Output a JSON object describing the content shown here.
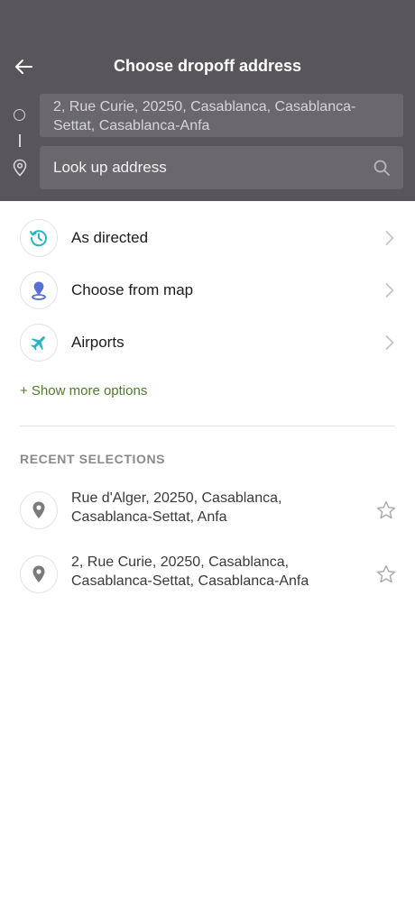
{
  "header": {
    "title": "Choose dropoff address",
    "pickup_address": "2, Rue Curie, 20250, Casablanca, Casablanca-Settat, Casablanca-Anfa",
    "lookup_placeholder": "Look up address",
    "background_color": "#58565a"
  },
  "options": [
    {
      "label": "As directed",
      "icon": "clock-arrow-icon"
    },
    {
      "label": "Choose from map",
      "icon": "map-pin-icon"
    },
    {
      "label": "Airports",
      "icon": "airplane-icon"
    }
  ],
  "show_more_label": "+ Show more options",
  "recent": {
    "heading": "RECENT SELECTIONS",
    "items": [
      {
        "address": "Rue d'Alger, 20250, Casablanca, Casablanca-Settat, Anfa"
      },
      {
        "address": "2, Rue Curie, 20250, Casablanca, Casablanca-Settat, Casablanca-Anfa"
      }
    ]
  },
  "colors": {
    "accent_teal": "#26b3c9",
    "map_blue": "#5a6fd6",
    "link_green": "#4e7a2b"
  }
}
